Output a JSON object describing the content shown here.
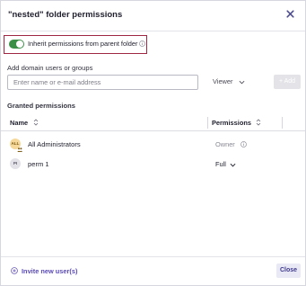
{
  "dialog": {
    "title": "\"nested\" folder permissions",
    "close_icon": "close-icon"
  },
  "inherit": {
    "label": "Inherit permissions from parent folder",
    "enabled": true,
    "toggle_color": "#3c8f47",
    "highlight_color": "#a02744"
  },
  "add_users": {
    "label": "Add domain users or groups",
    "placeholder": "Enter name or e-mail address",
    "value": "",
    "role": "Viewer",
    "add_label": "+ Add"
  },
  "granted": {
    "label": "Granted permissions",
    "columns": {
      "name": "Name",
      "permissions": "Permissions"
    },
    "rows": [
      {
        "initials": "ALL",
        "name": "All Administrators",
        "permission": "Owner",
        "editable": false
      },
      {
        "initials": "PI",
        "name": "perm 1",
        "permission": "Full",
        "editable": true
      }
    ]
  },
  "footer": {
    "invite_label": "Invite new user(s)",
    "close_label": "Close",
    "accent_color": "#5a4bb5"
  }
}
